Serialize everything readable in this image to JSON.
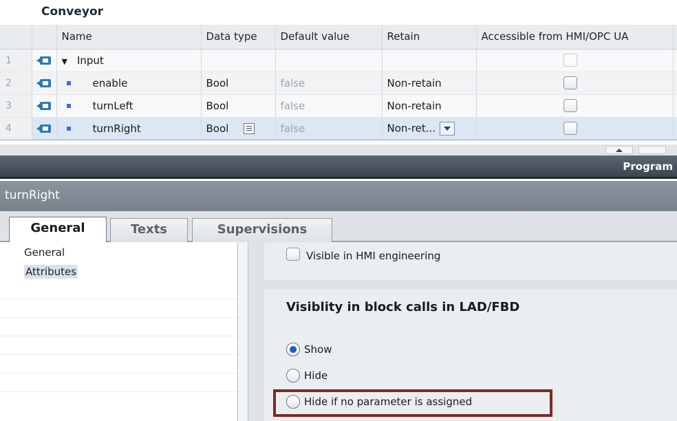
{
  "block": {
    "title": "Conveyor"
  },
  "table": {
    "columns": [
      "Name",
      "Data type",
      "Default value",
      "Retain",
      "Accessible from HMI/OPC UA"
    ],
    "rows": [
      {
        "num": "1",
        "name": "Input",
        "type": "",
        "default": "",
        "retain": ""
      },
      {
        "num": "2",
        "name": "enable",
        "type": "Bool",
        "default": "false",
        "retain": "Non-retain"
      },
      {
        "num": "3",
        "name": "turnLeft",
        "type": "Bool",
        "default": "false",
        "retain": "Non-retain"
      },
      {
        "num": "4",
        "name": "turnRight",
        "type": "Bool",
        "default": "false",
        "retain": "Non-ret..."
      }
    ]
  },
  "program_bar": {
    "label": "Program"
  },
  "inspector": {
    "title": "turnRight",
    "tabs": [
      "General",
      "Texts",
      "Supervisions"
    ],
    "nav": [
      "General",
      "Attributes"
    ],
    "hmi_label": "Visible in HMI engineering",
    "visibility": {
      "heading": "Visiblity in block calls in LAD/FBD",
      "options": [
        "Show",
        "Hide",
        "Hide if no parameter is assigned"
      ],
      "selected": "Show"
    }
  },
  "colors": {
    "accent": "#1f5fb5",
    "highlight": "#7b2a22",
    "title_bar": "#77828c"
  }
}
